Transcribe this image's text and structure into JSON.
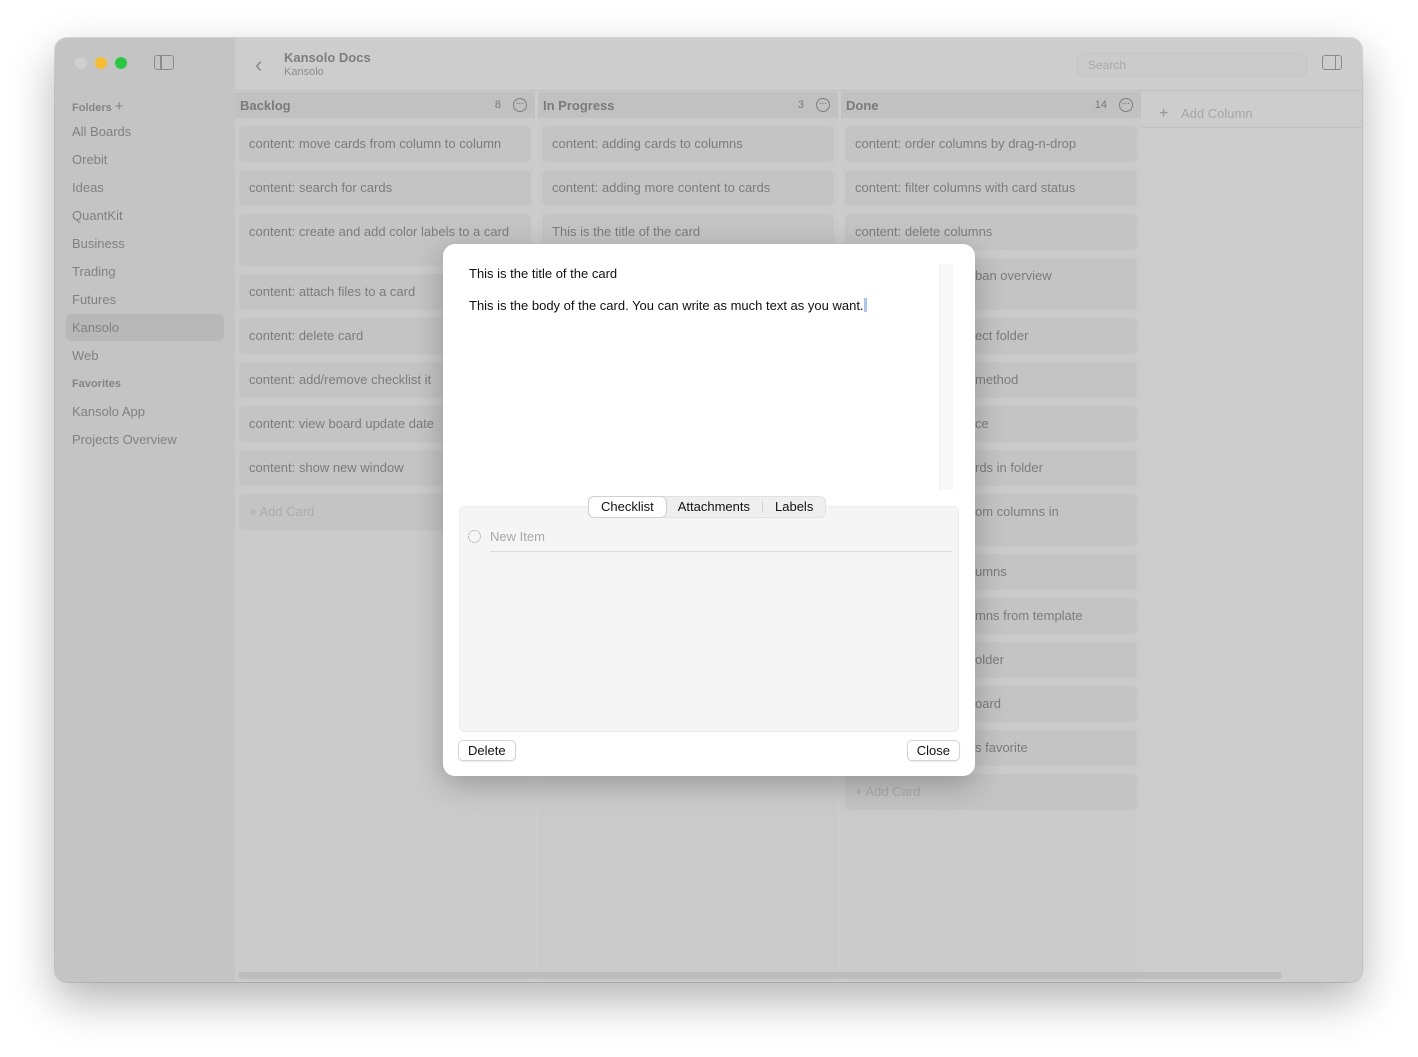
{
  "window": {
    "title": "Kansolo Docs",
    "subtitle": "Kansolo",
    "search_placeholder": "Search",
    "traffic_colors": [
      "#d0d0d0",
      "#f6be2f",
      "#2ac840"
    ]
  },
  "sidebar": {
    "folders_label": "Folders",
    "folders": [
      "All Boards",
      "Orebit",
      "Ideas",
      "QuantKit",
      "Business",
      "Trading",
      "Futures",
      "Kansolo",
      "Web"
    ],
    "selected": "Kansolo",
    "favorites_label": "Favorites",
    "favorites": [
      "Kansolo App",
      "Projects Overview"
    ]
  },
  "columns": [
    {
      "title": "Backlog",
      "count": "8",
      "cards": [
        "content: move cards from column to column",
        "content: search for cards",
        "content: create and add color labels to a card",
        "content: attach files to a card",
        "content: delete card",
        "content: add/remove checklist it",
        "content: view board update date",
        "content: show new window"
      ],
      "add_card": "+ Add Card"
    },
    {
      "title": "In Progress",
      "count": "3",
      "cards": [
        "content: adding cards to columns",
        "content: adding more content to cards",
        "This is the title of the card"
      ]
    },
    {
      "title": "Done",
      "count": "14",
      "cards": [
        "content: order columns by drag-n-drop",
        "content: filter columns with card status",
        "content: delete columns",
        "ban overview",
        "ect folder",
        "method",
        "ce",
        "rds in folder",
        "om columns in",
        "umns",
        "mns from template",
        "older",
        "oard",
        "s favorite"
      ],
      "add_card": "+ Add Card"
    }
  ],
  "add_column": "Add Column",
  "modal": {
    "title": "This is the title of the card",
    "body": "This is the body of the card. You can write as much text as you want.",
    "tabs": [
      "Checklist",
      "Attachments",
      "Labels"
    ],
    "active_tab": "Checklist",
    "new_item_placeholder": "New Item",
    "delete_label": "Delete",
    "close_label": "Close"
  }
}
